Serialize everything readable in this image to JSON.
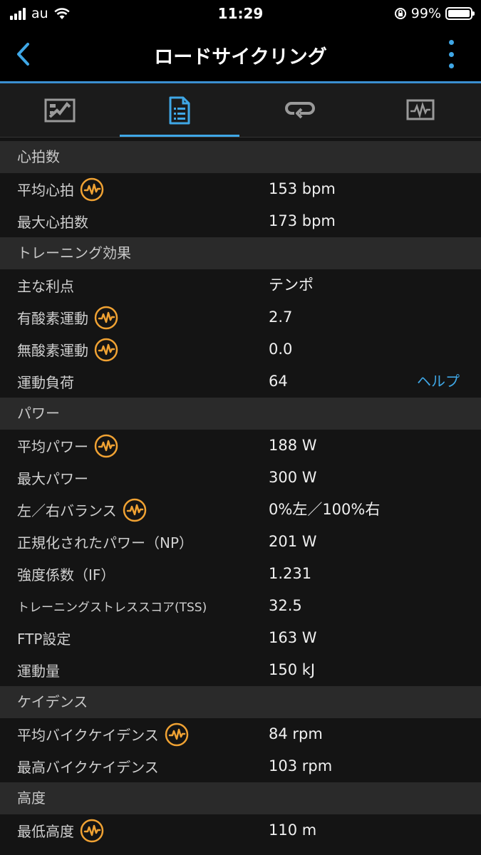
{
  "status_bar": {
    "carrier": "au",
    "time": "11:29",
    "battery": "99%"
  },
  "nav": {
    "title": "ロードサイクリング",
    "back_icon": "chevron-left-icon",
    "more_icon": "vertical-ellipsis-icon"
  },
  "tabs": [
    {
      "icon": "map-icon",
      "active": false
    },
    {
      "icon": "details-list-icon",
      "active": true
    },
    {
      "icon": "laps-icon",
      "active": false
    },
    {
      "icon": "graph-icon",
      "active": false
    }
  ],
  "colors": {
    "accent": "#3fa7e6",
    "metric_icon": "#f0a233",
    "background": "#141414",
    "section_header": "#2a2a2a"
  },
  "sections": {
    "heart_rate": {
      "title": "心拍数",
      "rows": [
        {
          "label": "平均心拍",
          "value": "153 bpm"
        },
        {
          "label": "最大心拍数",
          "value": "173 bpm"
        }
      ]
    },
    "training_effect": {
      "title": "トレーニング効果",
      "rows": [
        {
          "label": "主な利点",
          "value": "テンポ"
        },
        {
          "label": "有酸素運動",
          "value": "2.7"
        },
        {
          "label": "無酸素運動",
          "value": "0.0"
        },
        {
          "label": "運動負荷",
          "value": "64",
          "help": "ヘルプ"
        }
      ]
    },
    "power": {
      "title": "パワー",
      "rows": [
        {
          "label": "平均パワー",
          "value": "188 W"
        },
        {
          "label": "最大パワー",
          "value": "300 W"
        },
        {
          "label": "左／右バランス",
          "value": "0%左／100%右"
        },
        {
          "label": "正規化されたパワー（NP）",
          "value": "201 W"
        },
        {
          "label": "強度係数（IF）",
          "value": "1.231"
        },
        {
          "label": "トレーニングストレススコア(TSS)",
          "value": "32.5"
        },
        {
          "label": "FTP設定",
          "value": "163 W"
        },
        {
          "label": "運動量",
          "value": "150 kJ"
        }
      ]
    },
    "cadence": {
      "title": "ケイデンス",
      "rows": [
        {
          "label": "平均バイクケイデンス",
          "value": "84 rpm"
        },
        {
          "label": "最高バイクケイデンス",
          "value": "103 rpm"
        }
      ]
    },
    "elevation": {
      "title": "高度",
      "rows": [
        {
          "label": "最低高度",
          "value": "110 m"
        }
      ]
    }
  }
}
